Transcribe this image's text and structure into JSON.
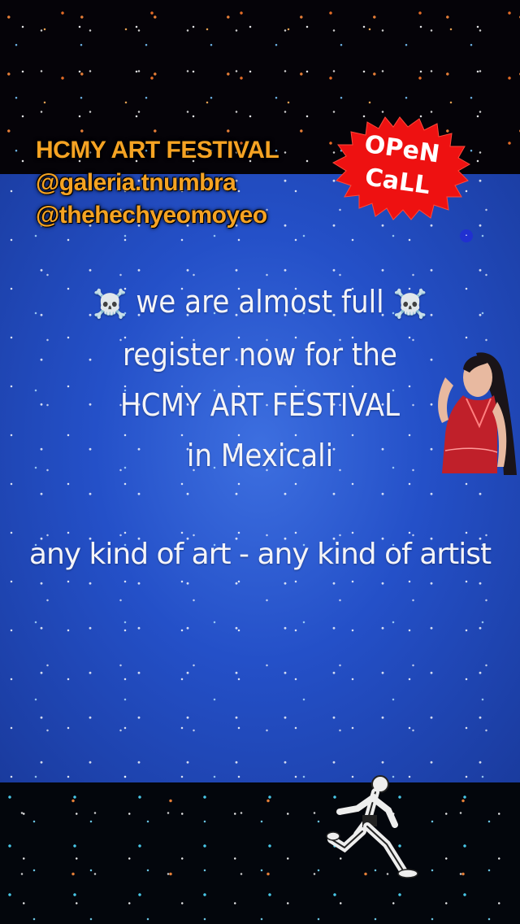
{
  "header": {
    "title": "HCMY ART FESTIVAL",
    "handle_1": "@galeria.tnumbra",
    "handle_2": "@thehechyeomoyeo"
  },
  "badge": {
    "line_1": "OPeN",
    "line_2": "CaLL",
    "color": "#ee1111"
  },
  "message": {
    "skull_emoji": "☠️",
    "line_1": "we are almost full",
    "line_2": "register now for the",
    "line_3": "HCMY ART FESTIVAL",
    "line_4": "in Mexicali"
  },
  "tagline": "any kind of art - any kind of artist",
  "stickers": {
    "person_icon": "person-sticker",
    "runner_icon": "runner-sticker"
  },
  "colors": {
    "header_text": "#f5a323",
    "panel_blue": "#2450c8",
    "body_text": "#f4f4f8"
  }
}
